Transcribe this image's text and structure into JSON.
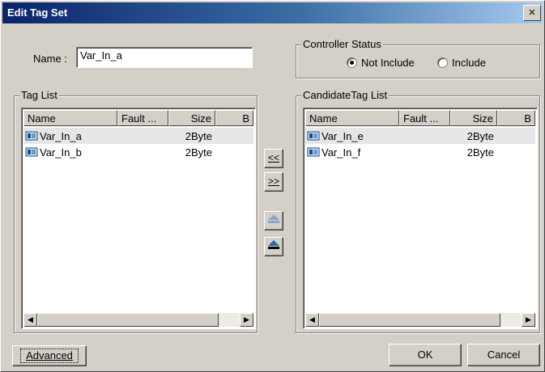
{
  "window": {
    "title": "Edit Tag Set",
    "close_glyph": "×"
  },
  "name_field": {
    "label": "Name :",
    "value": "Var_In_a"
  },
  "controller_status": {
    "legend": "Controller Status",
    "options": [
      {
        "label": "Not Include",
        "selected": true
      },
      {
        "label": "Include",
        "selected": false
      }
    ]
  },
  "tag_list": {
    "legend": "Tag List",
    "columns": [
      "Name",
      "Fault ...",
      "Size",
      "B"
    ],
    "rows": [
      {
        "name": "Var_In_a",
        "fault": "",
        "size": "2Byte",
        "selected": true
      },
      {
        "name": "Var_In_b",
        "fault": "",
        "size": "2Byte",
        "selected": false
      }
    ]
  },
  "candidate_list": {
    "legend": "CandidateTag List",
    "columns": [
      "Name",
      "Fault ...",
      "Size",
      "B"
    ],
    "rows": [
      {
        "name": "Var_In_e",
        "fault": "",
        "size": "2Byte",
        "selected": true
      },
      {
        "name": "Var_In_f",
        "fault": "",
        "size": "2Byte",
        "selected": false
      }
    ]
  },
  "transfer_buttons": {
    "add_label": "<<",
    "remove_label": ">>"
  },
  "icons": {
    "tag": "tag-icon",
    "move_up": "move-up-icon",
    "move_down": "move-down-icon",
    "scroll_left": "scroll-left-icon",
    "scroll_right": "scroll-right-icon"
  },
  "footer": {
    "advanced_label": "Advanced",
    "ok_label": "OK",
    "cancel_label": "Cancel"
  },
  "colors": {
    "titlebar_start": "#0a246a",
    "titlebar_end": "#a6caf0",
    "dialog_face": "#d4d0c8"
  }
}
